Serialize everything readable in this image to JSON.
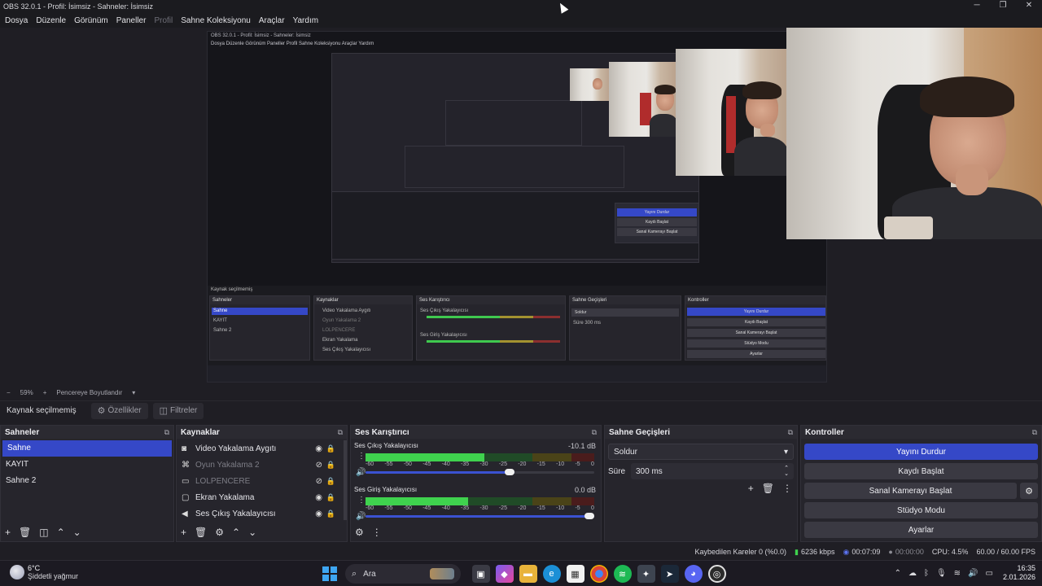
{
  "window": {
    "title": "OBS 32.0.1 - Profil: İsimsiz - Sahneler: İsimsiz",
    "controls": [
      "─",
      "❐",
      "✕"
    ]
  },
  "menu": [
    "Dosya",
    "Düzenle",
    "Görünüm",
    "Paneller",
    "Profil",
    "Sahne Koleksiyonu",
    "Araçlar",
    "Yardım"
  ],
  "preview_footer": {
    "minus": "−",
    "zoom": "59%",
    "plus": "+",
    "mode": "Pencereye Boyutlandır",
    "caret": "▾"
  },
  "context": {
    "no_selection": "Kaynak seçilmemiş",
    "properties": "Özellikler",
    "filters": "Filtreler"
  },
  "scenes": {
    "title": "Sahneler",
    "items": [
      "Sahne",
      "KAYIT",
      "Sahne 2"
    ],
    "selected": 0
  },
  "sources": {
    "title": "Kaynaklar",
    "items": [
      {
        "label": "Video Yakalama Aygıtı",
        "icon": "camera-icon",
        "visible": true
      },
      {
        "label": "Oyun Yakalama 2",
        "icon": "gamepad-icon",
        "visible": false
      },
      {
        "label": "LOLPENCERE",
        "icon": "window-icon",
        "visible": false
      },
      {
        "label": "Ekran Yakalama",
        "icon": "monitor-icon",
        "visible": true
      },
      {
        "label": "Ses Çıkış Yakalayıcısı",
        "icon": "speaker-icon",
        "visible": true
      }
    ]
  },
  "mixer": {
    "title": "Ses Karıştırıcı",
    "channels": [
      {
        "name": "Ses Çıkış Yakalayıcısı",
        "db": "-10.1 dB",
        "level": 0.52,
        "volume": 0.65
      },
      {
        "name": "Ses Giriş Yakalayıcısı",
        "db": "0.0 dB",
        "level": 0.45,
        "volume": 1.0
      }
    ],
    "ticks": [
      "-60",
      "-55",
      "-50",
      "-45",
      "-40",
      "-35",
      "-30",
      "-25",
      "-20",
      "-15",
      "-10",
      "-5",
      "0"
    ]
  },
  "transitions": {
    "title": "Sahne Geçişleri",
    "selected": "Soldur",
    "duration_label": "Süre",
    "duration": "300 ms"
  },
  "controls": {
    "title": "Kontroller",
    "stop_stream": "Yayını Durdur",
    "start_record": "Kaydı Başlat",
    "start_virtualcam": "Sanal Kamerayı Başlat",
    "studio_mode": "Stüdyo Modu",
    "settings": "Ayarlar"
  },
  "status": {
    "dropped": "Kaybedilen Kareler 0 (%0.0)",
    "bitrate": "6236 kbps",
    "stream_time": "00:07:09",
    "record_time": "00:00:00",
    "cpu": "CPU: 4.5%",
    "fps": "60.00 / 60.00 FPS"
  },
  "taskbar": {
    "temp": "6°C",
    "weather": "Şiddetli yağmur",
    "search": "Ara",
    "time": "16:35",
    "date": "2.01.2026"
  },
  "colors": {
    "accent": "#3548c7",
    "meter_green": "#3fd24e",
    "bg": "#1f1e24",
    "dock": "#26252c"
  }
}
